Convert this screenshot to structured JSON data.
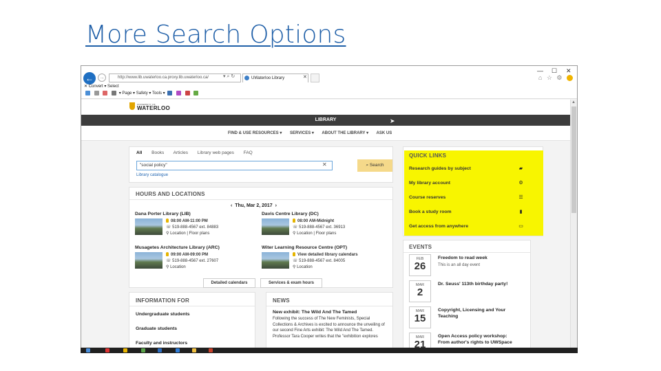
{
  "slide": {
    "title": "More Search Options"
  },
  "browser": {
    "address": "http://www.lib.uwaterloo.ca.proxy.lib.uwaterloo.ca/",
    "tab_label": "UWaterloo Library",
    "cmd_row1": "✕  Convert  ▾  Select",
    "cmd_row2": "▾  Page ▾  Safety ▾  Tools ▾"
  },
  "site": {
    "logo_small": "UNIVERSITY OF",
    "logo_big": "WATERLOO",
    "library_label": "LIBRARY",
    "nav": [
      "FIND & USE RESOURCES ▾",
      "SERVICES ▾",
      "ABOUT THE LIBRARY ▾",
      "ASK US"
    ]
  },
  "search": {
    "tabs": [
      "All",
      "Books",
      "Articles",
      "Library web pages",
      "FAQ"
    ],
    "active_tab": "All",
    "query": "\"social policy\"",
    "button": "Search",
    "link": "Library catalogue"
  },
  "hours": {
    "header": "HOURS AND LOCATIONS",
    "date": "Thu, Mar 2, 2017",
    "libraries": [
      {
        "name": "Dana Porter Library (LIB)",
        "hours": "08:00 AM-11:00 PM",
        "phone": "519-888-4567 ext. 84883",
        "loc": "Location | Floor plans"
      },
      {
        "name": "Davis Centre Library (DC)",
        "hours": "08:00 AM-Midnight",
        "phone": "519-888-4567 ext. 36913",
        "loc": "Location | Floor plans"
      },
      {
        "name": "Musagetes Architecture Library (ARC)",
        "hours": "09:00 AM-09:00 PM",
        "phone": "519-888-4567 ext. 27607",
        "loc": "Location"
      },
      {
        "name": "Witer Learning Resource Centre (OPT)",
        "hours": "View detailed library calendars",
        "phone": "519-888-4567 ext. 84005",
        "loc": "Location"
      }
    ],
    "btn_calendars": "Detailed calendars",
    "btn_services": "Services & exam hours"
  },
  "info": {
    "header": "INFORMATION FOR",
    "items": [
      "Undergraduate students",
      "Graduate students",
      "Faculty and instructors"
    ]
  },
  "news": {
    "header": "NEWS",
    "title": "New exhibit: The Wild And The Tamed",
    "body": "Following the success of The New Feminists, Special Collections & Archives is excited to announce the unveiling of our second Fine Arts exhibit: The Wild And The Tamed. Professor Tara Cooper writes that the \"exhibition explores"
  },
  "quick_links": {
    "header": "QUICK LINKS",
    "highlight_color": "#f8f500",
    "items": [
      {
        "label": "Research guides by subject",
        "icon": "folder-icon"
      },
      {
        "label": "My library account",
        "icon": "gear-icon"
      },
      {
        "label": "Course reserves",
        "icon": "list-icon"
      },
      {
        "label": "Book a study room",
        "icon": "book-icon"
      },
      {
        "label": "Get access from anywhere",
        "icon": "monitor-icon"
      }
    ]
  },
  "events": {
    "header": "EVENTS",
    "items": [
      {
        "month": "FEB",
        "day": "26",
        "title": "Freedom to read week",
        "sub": "This is an all day event"
      },
      {
        "month": "MAR",
        "day": "2",
        "title": "Dr. Seuss' 113th birthday party!",
        "sub": ""
      },
      {
        "month": "MAR",
        "day": "15",
        "title": "Copyright, Licensing and Your",
        "title2": "Teaching",
        "sub": ""
      },
      {
        "month": "MAR",
        "day": "21",
        "title": "Open Access policy workshop:",
        "title2": "From author's rights to UWSpace",
        "sub": ""
      }
    ]
  }
}
